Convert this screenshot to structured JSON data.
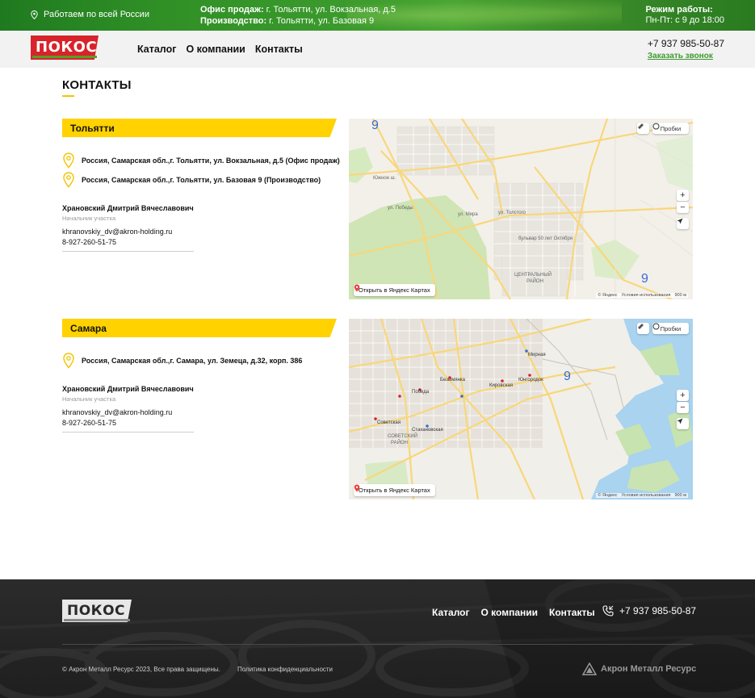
{
  "topbar": {
    "region": "Работаем по всей России",
    "office_label": "Офис продаж:",
    "office_value": " г. Тольятти, ул. Вокзальная, д.5",
    "production_label": "Производство:",
    "production_value": " г. Тольятти, ул. Базовая 9",
    "hours_label": "Режим работы:",
    "hours_value": "Пн-Пт: с 9 до 18:00"
  },
  "header": {
    "logo_text": "ПОКОС",
    "nav": [
      "Каталог",
      "О компании",
      "Контакты"
    ],
    "phone": "+7 937 985-50-87",
    "callback": "Заказать звонок"
  },
  "page": {
    "title": "КОНТАКТЫ"
  },
  "cities": [
    {
      "name": "Тольятти",
      "addresses": [
        "Россия, Самарская обл.,г. Тольятти, ул. Вокзальная, д.5 (Офис продаж)",
        "Россия, Самарская обл.,г. Тольятти, ул. Базовая 9 (Производство)"
      ],
      "contact": {
        "name": "Храновский Дмитрий Вячеславович",
        "role": "Начальник участка",
        "email": "khranovskiy_dv@akron-holding.ru",
        "phone": "8-927-260-51-75"
      },
      "map": {
        "traffic": "Пробки",
        "open": "Открыть в Яндекс Картах",
        "copyright": "© Яндекс",
        "terms": "Условия использования",
        "scale": "900 м",
        "labels": [
          "ЦЕНТРАЛЬНЫЙ",
          "РАЙОН",
          "ул. Мира",
          "Южное ш.",
          "бульвар 50 лет Октября",
          "ул. Толстого",
          "ул. Победы"
        ]
      }
    },
    {
      "name": "Самара",
      "addresses": [
        "Россия, Самарская обл.,г. Самара, ул. Земеца, д.32, корп. 386"
      ],
      "contact": {
        "name": "Храновский Дмитрий Вячеславович",
        "role": "Начальник участка",
        "email": "khranovskiy_dv@akron-holding.ru",
        "phone": "8-927-260-51-75"
      },
      "map": {
        "traffic": "Пробки",
        "open": "Открыть в Яндекс Картах",
        "copyright": "© Яндекс",
        "terms": "Условия использования",
        "scale": "900 м",
        "labels": [
          "СОВЕТСКИЙ",
          "РАЙОН",
          "Мирная",
          "Безымянка",
          "Победа",
          "Кировская",
          "Юнгородок",
          "Советская",
          "Стахановская"
        ]
      }
    }
  ],
  "footer": {
    "logo_text": "ПОКОС",
    "nav": [
      "Каталог",
      "О компании",
      "Контакты"
    ],
    "phone": "+7 937 985-50-87",
    "copyright": "© Акрон Металл Ресурс 2023, Все права защищены.",
    "policy": "Политика конфиденциальности",
    "brand": "Акрон Металл Ресурс"
  },
  "colors": {
    "accent_yellow": "#ffd200",
    "brand_red": "#d8232a",
    "brand_green": "#3d9a2e"
  }
}
